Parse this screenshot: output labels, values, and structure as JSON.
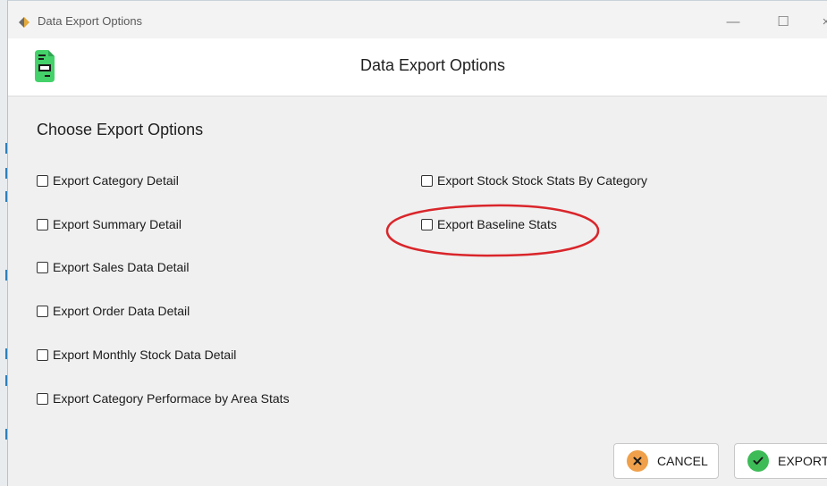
{
  "window": {
    "title": "Data Export Options",
    "minimize_glyph": "—",
    "maximize_glyph": "☐",
    "close_glyph": "×"
  },
  "header": {
    "title": "Data Export Options",
    "icon": "document-export-icon"
  },
  "main": {
    "section_title": "Choose Export Options",
    "left_options": [
      {
        "label": "Export Category Detail",
        "checked": false
      },
      {
        "label": "Export Summary Detail",
        "checked": false
      },
      {
        "label": "Export Sales Data Detail",
        "checked": false
      },
      {
        "label": "Export Order Data Detail",
        "checked": false
      },
      {
        "label": "Export Monthly Stock Data Detail",
        "checked": false
      },
      {
        "label": "Export Category Performace by Area Stats",
        "checked": false
      }
    ],
    "right_options": [
      {
        "label": "Export Stock Stock Stats By Category",
        "checked": false
      },
      {
        "label": "Export Baseline Stats",
        "checked": false
      }
    ]
  },
  "footer": {
    "cancel_label": "CANCEL",
    "export_label": "EXPORT"
  },
  "colors": {
    "accent_green": "#3dbb57",
    "cancel_orange": "#f0a04a",
    "highlight_red": "#d9262b",
    "header_icon_green": "#44d16a"
  }
}
